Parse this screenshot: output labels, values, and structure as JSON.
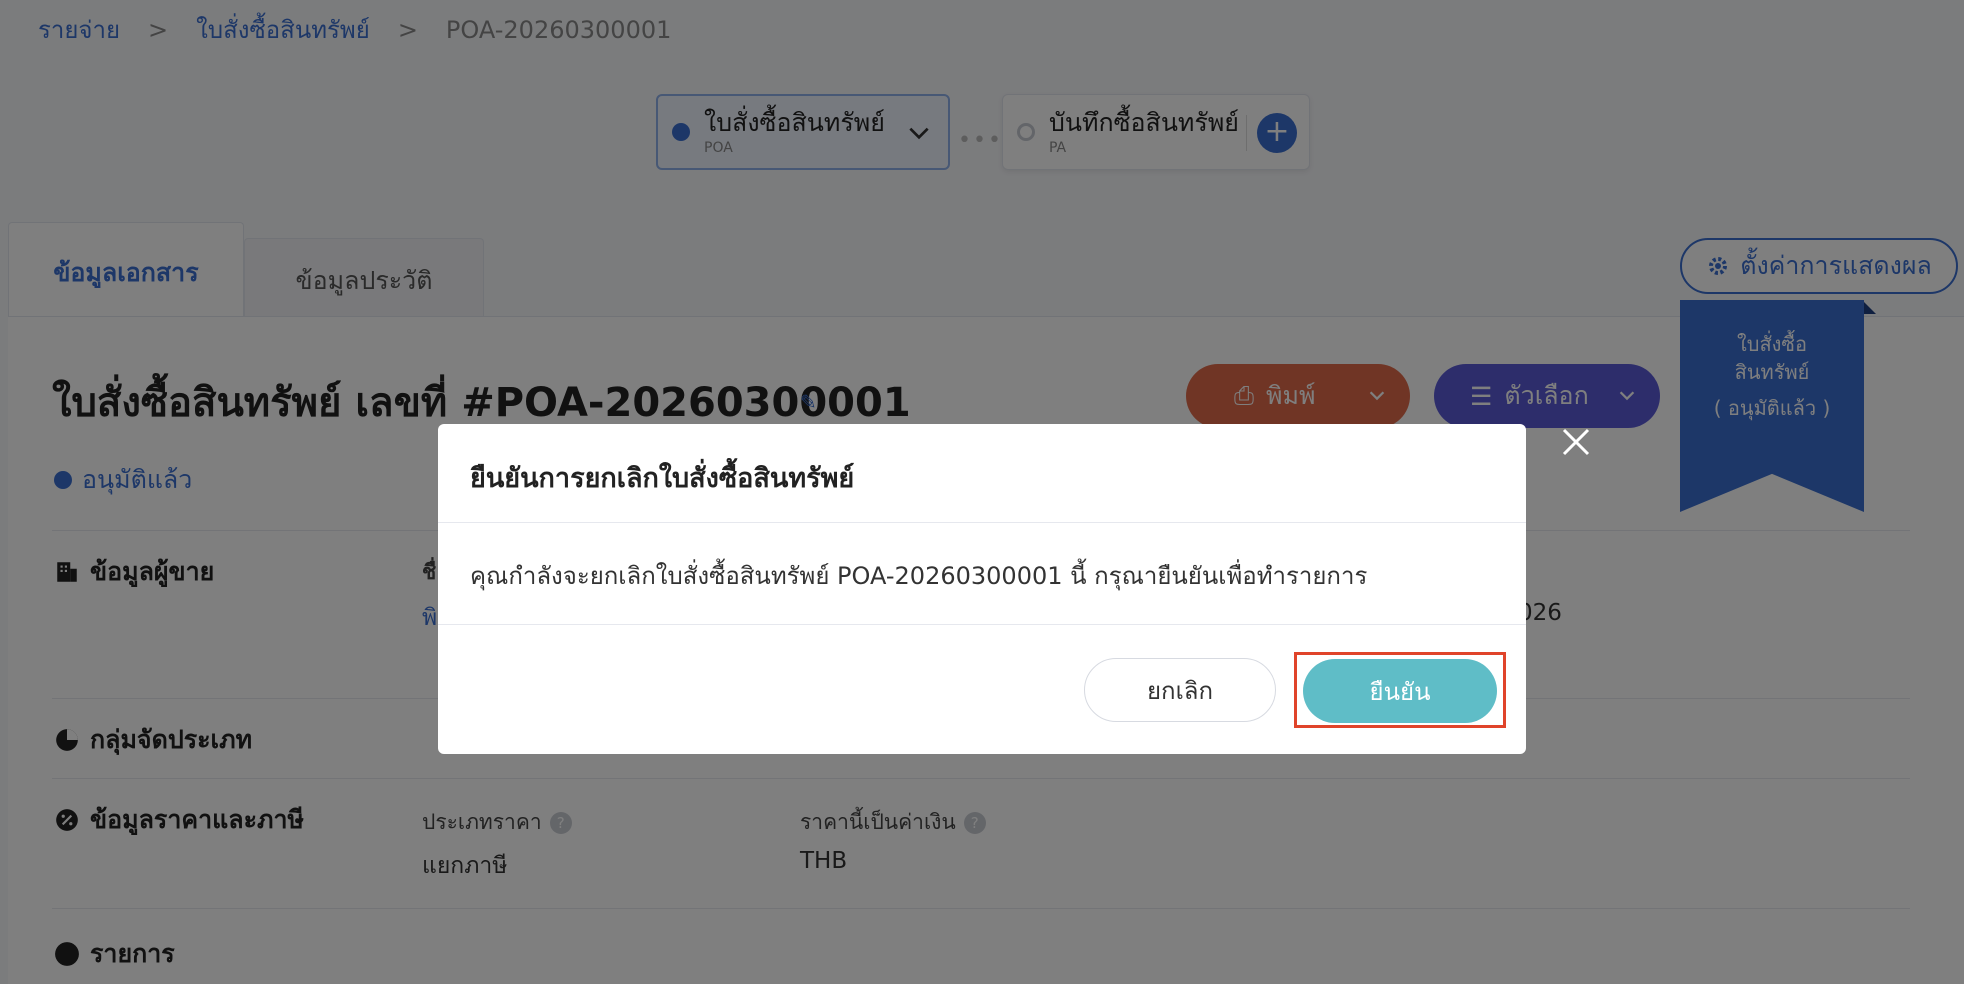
{
  "breadcrumb": {
    "items": [
      "รายจ่าย",
      "ใบสั่งซื้อสินทรัพย์",
      "POA-20260300001"
    ],
    "separator": ">"
  },
  "stepper": {
    "steps": [
      {
        "title": "ใบสั่งซื้อสินทรัพย์",
        "code": "POA",
        "state": "active"
      },
      {
        "title": "บันทึกซื้อสินทรัพย์",
        "code": "PA",
        "state": "pending"
      }
    ],
    "add_label": "+"
  },
  "tabs": [
    {
      "label": "ข้อมูลเอกสาร",
      "active": true
    },
    {
      "label": "ข้อมูลประวัติ",
      "active": false
    }
  ],
  "settings_button": "ตั้งค่าการแสดงผล",
  "ribbon": {
    "line1": "ใบสั่งซื้อ",
    "line2": "สินทรัพย์",
    "line3": "( อนุมัติแล้ว )"
  },
  "document": {
    "title": "ใบสั่งซื้อสินทรัพย์ เลขที่ #POA-20260300001",
    "status": "อนุมัติแล้ว",
    "print_label": "พิมพ์",
    "options_label": "ตัวเลือก"
  },
  "sections": {
    "vendor": "ข้อมูลผู้ขาย",
    "category": "กลุ่มจัดประเภท",
    "pricing": "ข้อมูลราคาและภาษี",
    "items": "รายการ"
  },
  "vendor_partial": {
    "label_fragment": "ชื่",
    "value_fragment": "พิ",
    "date_fragment": "026"
  },
  "pricing_fields": {
    "price_type_label": "ประเภทราคา",
    "price_type_value": "แยกภาษี",
    "currency_label": "ราคานี้เป็นค่าเงิน",
    "currency_value": "THB",
    "help_glyph": "?"
  },
  "modal": {
    "title": "ยืนยันการยกเลิกใบสั่งซื้อสินทรัพย์",
    "body": "คุณกำลังจะยกเลิกใบสั่งซื้อสินทรัพย์ POA-20260300001 นี้ กรุณายืนยันเพื่อทำรายการ",
    "cancel_label": "ยกเลิก",
    "confirm_label": "ยืนยัน"
  },
  "colors": {
    "primary": "#3b6fd1",
    "print": "#e06a4a",
    "options": "#5a5ad6",
    "confirm": "#5fbdc7",
    "highlight": "#e0442a"
  }
}
